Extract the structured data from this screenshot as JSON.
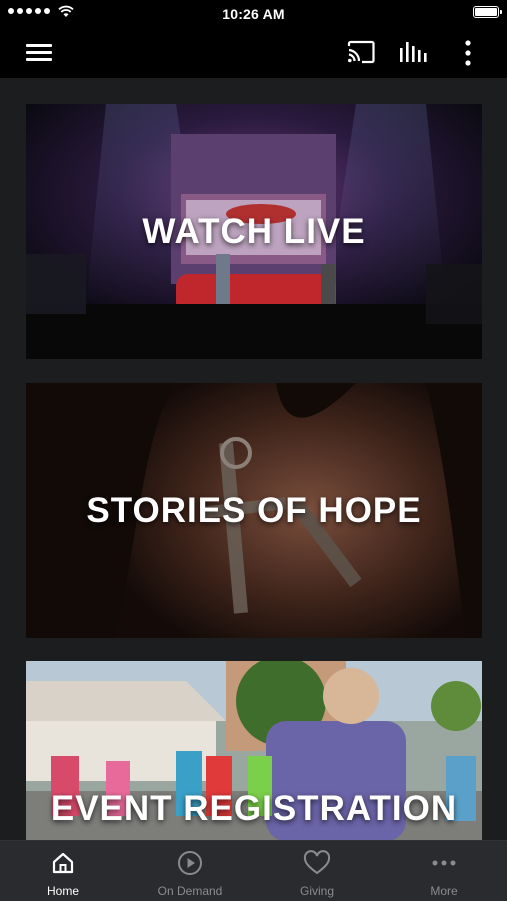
{
  "status_bar": {
    "time": "10:26 AM",
    "signal_icon": "signal-dots-icon",
    "wifi_icon": "wifi-icon",
    "battery_icon": "battery-full-icon"
  },
  "nav_bar": {
    "menu_icon": "hamburger-menu-icon",
    "cast_icon": "cast-icon",
    "audio_icon": "audio-bars-icon",
    "more_icon": "vertical-dots-icon"
  },
  "tiles": [
    {
      "title": "WATCH LIVE"
    },
    {
      "title": "STORIES OF HOPE"
    },
    {
      "title": "EVENT REGISTRATION"
    }
  ],
  "tab_bar": {
    "tabs": [
      {
        "label": "Home",
        "icon": "home-icon",
        "active": true
      },
      {
        "label": "On Demand",
        "icon": "play-circle-icon",
        "active": false
      },
      {
        "label": "Giving",
        "icon": "heart-icon",
        "active": false
      },
      {
        "label": "More",
        "icon": "more-dots-icon",
        "active": false
      }
    ]
  },
  "colors": {
    "background": "#1c1d1f",
    "bars": "#000000",
    "tab_bar": "#2a2b2e",
    "active_tab": "#ffffff",
    "inactive_tab": "#8a8b8e"
  }
}
